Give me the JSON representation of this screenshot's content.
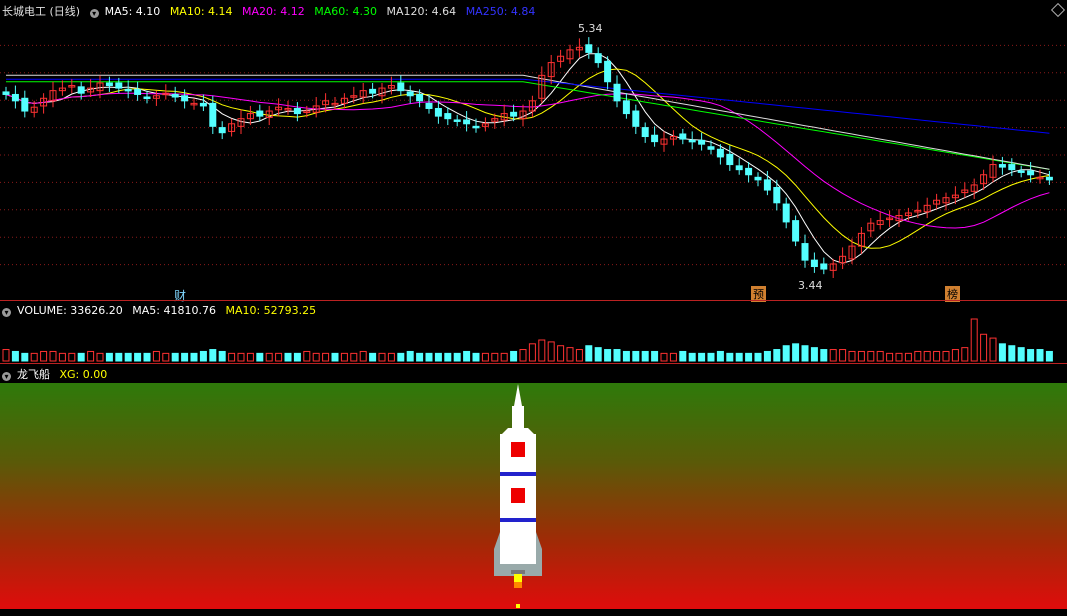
{
  "price_header": {
    "stock_name": "长城电工 (日线)",
    "ma5": "MA5: 4.10",
    "ma10": "MA10: 4.14",
    "ma20": "MA20: 4.12",
    "ma60": "MA60: 4.30",
    "ma120": "MA120: 4.64",
    "ma250": "MA250: 4.84"
  },
  "volume_header": {
    "volume": "VOLUME: 33626.20",
    "ma5": "MA5: 41810.76",
    "ma10": "MA10: 52793.25"
  },
  "indicator_header": {
    "name": "龙飞船",
    "xg": "XG: 0.00"
  },
  "annotations": {
    "high_label": "5.34",
    "low_label": "3.44",
    "marker_cai": "财",
    "marker_yu": "预",
    "marker_bang": "榜"
  },
  "colors": {
    "ma5": "#ffffff",
    "ma10": "#ffff00",
    "ma20": "#ff00ff",
    "ma60": "#00ff00",
    "ma120": "#dddddd",
    "ma250": "#0000ff",
    "up": "#ff3232",
    "down": "#54ffff",
    "separator": "#b22222"
  },
  "chart_data": {
    "type": "candlestick",
    "price_range": [
      3.3,
      5.45
    ],
    "closes": [
      4.85,
      4.8,
      4.72,
      4.75,
      4.82,
      4.88,
      4.9,
      4.92,
      4.86,
      4.9,
      4.94,
      4.92,
      4.9,
      4.88,
      4.85,
      4.82,
      4.84,
      4.86,
      4.83,
      4.8,
      4.78,
      4.76,
      4.6,
      4.55,
      4.62,
      4.66,
      4.7,
      4.68,
      4.72,
      4.75,
      4.74,
      4.7,
      4.72,
      4.76,
      4.8,
      4.78,
      4.82,
      4.84,
      4.88,
      4.86,
      4.9,
      4.92,
      4.88,
      4.84,
      4.8,
      4.74,
      4.68,
      4.66,
      4.64,
      4.62,
      4.6,
      4.62,
      4.66,
      4.7,
      4.68,
      4.72,
      4.8,
      5.0,
      5.1,
      5.15,
      5.2,
      5.22,
      5.18,
      5.1,
      4.95,
      4.8,
      4.7,
      4.6,
      4.52,
      4.48,
      4.5,
      4.52,
      4.5,
      4.48,
      4.46,
      4.42,
      4.36,
      4.3,
      4.26,
      4.22,
      4.18,
      4.1,
      4.0,
      3.85,
      3.7,
      3.55,
      3.5,
      3.48,
      3.52,
      3.58,
      3.66,
      3.76,
      3.84,
      3.86,
      3.88,
      3.9,
      3.92,
      3.94,
      3.98,
      4.02,
      4.04,
      4.06,
      4.1,
      4.14,
      4.22,
      4.3,
      4.28,
      4.26,
      4.24,
      4.22,
      4.2,
      4.18
    ],
    "volumes": [
      6,
      5,
      4,
      4,
      5,
      5,
      4,
      4,
      4,
      5,
      4,
      4,
      4,
      4,
      4,
      4,
      5,
      4,
      4,
      4,
      4,
      5,
      6,
      5,
      4,
      4,
      4,
      4,
      4,
      4,
      4,
      4,
      5,
      4,
      4,
      4,
      4,
      4,
      5,
      4,
      4,
      4,
      4,
      5,
      4,
      4,
      4,
      4,
      4,
      5,
      4,
      4,
      4,
      4,
      5,
      6,
      9,
      11,
      10,
      8,
      7,
      6,
      8,
      7,
      6,
      6,
      5,
      5,
      5,
      5,
      4,
      4,
      5,
      4,
      4,
      4,
      5,
      4,
      4,
      4,
      4,
      5,
      6,
      8,
      9,
      8,
      7,
      6,
      6,
      6,
      5,
      5,
      5,
      5,
      4,
      4,
      4,
      5,
      5,
      5,
      5,
      6,
      7,
      22,
      14,
      12,
      9,
      8,
      7,
      6,
      6,
      5
    ],
    "indicator_xg": 0.0
  }
}
